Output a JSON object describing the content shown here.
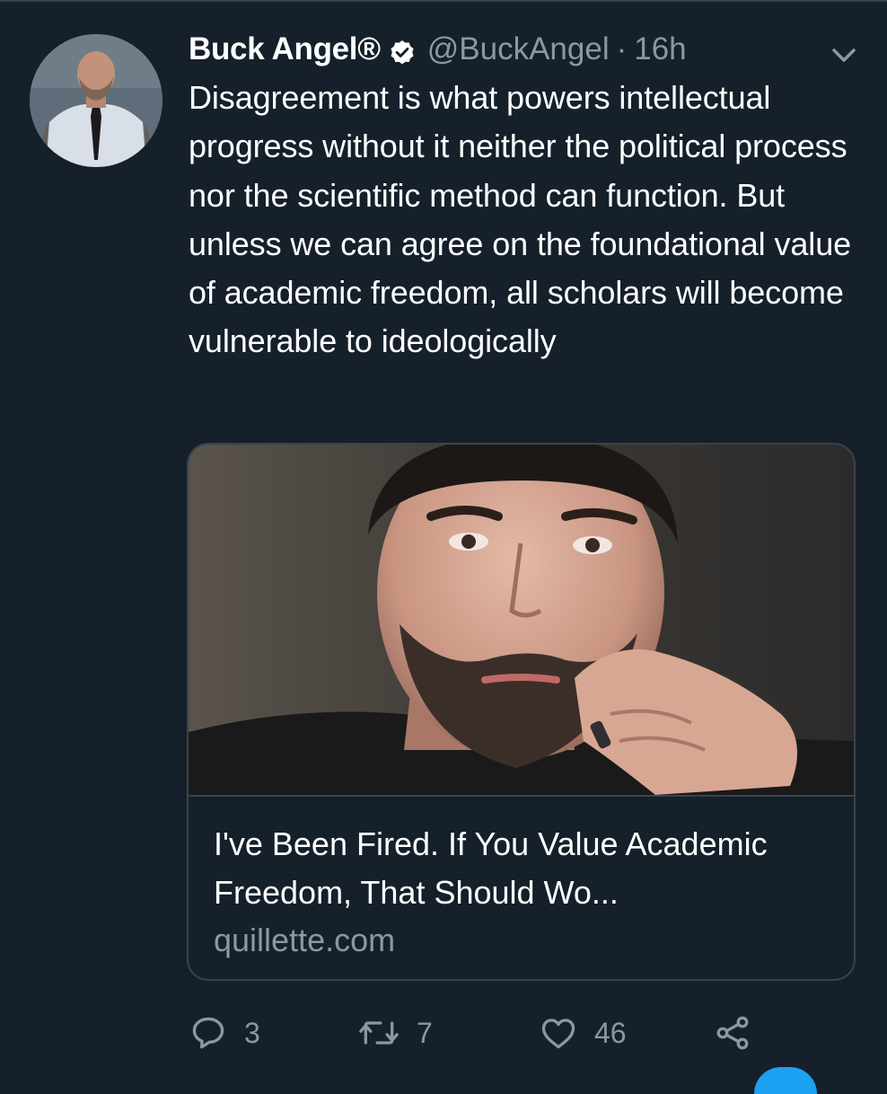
{
  "tweet": {
    "display_name": "Buck Angel®",
    "handle": "@BuckAngel",
    "separator": "·",
    "timestamp": "16h",
    "text": "Disagreement is what powers intellectual progress without it neither the political process nor the scientific method can function. But unless we can agree on the foundational value of academic freedom, all scholars will become vulnerable to ideologically"
  },
  "card": {
    "title": "I've Been Fired. If You Value Academic Freedom, That Should Wo...",
    "domain": "quillette.com"
  },
  "actions": {
    "replies": "3",
    "retweets": "7",
    "likes": "46"
  },
  "icons": {
    "verified": "verified-badge-icon",
    "caret": "chevron-down-icon",
    "reply": "reply-icon",
    "retweet": "retweet-icon",
    "like": "heart-icon",
    "share": "share-icon"
  },
  "colors": {
    "background": "#15202b",
    "secondary_text": "#8899a6",
    "border": "#38444d",
    "accent": "#1da1f2"
  }
}
